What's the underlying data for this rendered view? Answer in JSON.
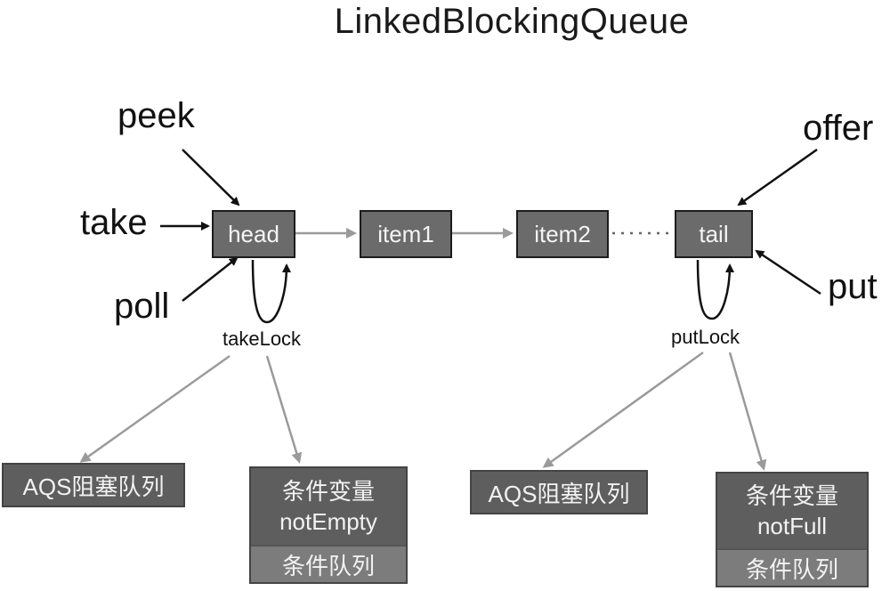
{
  "title": "LinkedBlockingQueue",
  "operations": {
    "peek": "peek",
    "take": "take",
    "poll": "poll",
    "offer": "offer",
    "put": "put"
  },
  "nodes": {
    "head": "head",
    "item1": "item1",
    "item2": "item2",
    "tail": "tail"
  },
  "locks": {
    "take": "takeLock",
    "put": "putLock"
  },
  "take_side": {
    "aqs": "AQS阻塞队列",
    "condition_line1": "条件变量",
    "condition_line2": "notEmpty",
    "condition_queue": "条件队列"
  },
  "put_side": {
    "aqs": "AQS阻塞队列",
    "condition_line1": "条件变量",
    "condition_line2": "notFull",
    "condition_queue": "条件队列"
  },
  "colors": {
    "node_fill": "#6b6b6b",
    "box_fill": "#5e5e5e",
    "gray_arrow": "#9a9a9a",
    "black_arrow": "#111111"
  }
}
